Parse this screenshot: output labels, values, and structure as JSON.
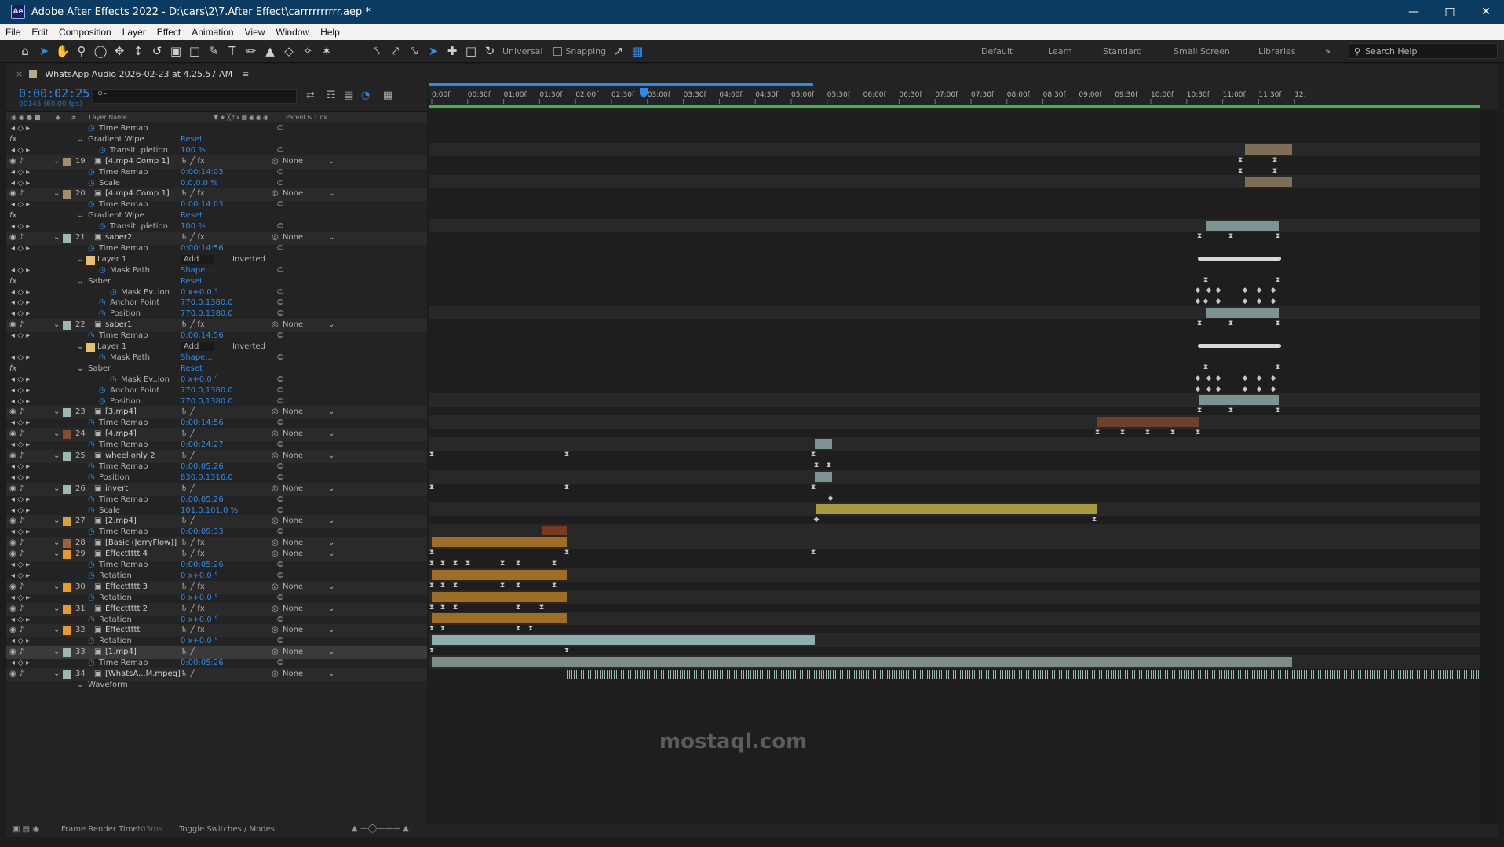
{
  "title": "Adobe After Effects 2022 - D:\\cars\\2\\7.After Effect\\carrrrrrrrrr.aep *",
  "menu": [
    "File",
    "Edit",
    "Composition",
    "Layer",
    "Effect",
    "Animation",
    "View",
    "Window",
    "Help"
  ],
  "toolbar": {
    "universal": "Universal",
    "snapping": "Snapping"
  },
  "workspaces": [
    "Default",
    "Learn",
    "Standard",
    "Small Screen",
    "Libraries"
  ],
  "search_help": "Search Help",
  "panel": {
    "comp_name": "WhatsApp Audio 2026-02-23 at 4.25.57 AM",
    "timecode": "0:00:02:25",
    "fps": "00145 (60.00 fps)"
  },
  "columns": {
    "layer_name": "Layer Name",
    "parent": "Parent & Link"
  },
  "ruler": [
    "0:00f",
    "00:30f",
    "01:00f",
    "01:30f",
    "02:00f",
    "02:30f",
    "03:00f",
    "03:30f",
    "04:00f",
    "04:30f",
    "05:00f",
    "05:30f",
    "06:00f",
    "06:30f",
    "07:00f",
    "07:30f",
    "08:00f",
    "08:30f",
    "09:00f",
    "09:30f",
    "10:00f",
    "10:30f",
    "11:00f",
    "11:30f",
    "12:"
  ],
  "rows": [
    {
      "t": "prop",
      "ind": 2,
      "name": "Time Remap",
      "val": ""
    },
    {
      "t": "group",
      "ind": 1,
      "name": "Gradient Wipe",
      "val": "Reset",
      "fx": true
    },
    {
      "t": "prop",
      "ind": 3,
      "name": "Transit..pletion",
      "val": "100 %"
    },
    {
      "t": "layer",
      "num": "19",
      "name": "[4.mp4 Comp 1]",
      "color": "#a58f6a",
      "parent": "None",
      "fx": true
    },
    {
      "t": "prop",
      "ind": 2,
      "name": "Time Remap",
      "val": "0:00:14:03"
    },
    {
      "t": "prop",
      "ind": 2,
      "name": "Scale",
      "val": "0.0,0.0 %"
    },
    {
      "t": "layer",
      "num": "20",
      "name": "[4.mp4 Comp 1]",
      "color": "#a58f6a",
      "parent": "None",
      "fx": true
    },
    {
      "t": "prop",
      "ind": 2,
      "name": "Time Remap",
      "val": "0:00:14:03"
    },
    {
      "t": "group",
      "ind": 1,
      "name": "Gradient Wipe",
      "val": "Reset",
      "fx": true
    },
    {
      "t": "prop",
      "ind": 3,
      "name": "Transit..pletion",
      "val": "100 %"
    },
    {
      "t": "layer",
      "num": "21",
      "name": "saber2",
      "color": "#9fb7b4",
      "parent": "None",
      "fx": true
    },
    {
      "t": "prop",
      "ind": 2,
      "name": "Time Remap",
      "val": "0:00:14:56"
    },
    {
      "t": "mask",
      "ind": 1,
      "name": "Layer 1",
      "mode": "Add",
      "inv": "Inverted"
    },
    {
      "t": "prop",
      "ind": 3,
      "name": "Mask Path",
      "val": "Shape..."
    },
    {
      "t": "group",
      "ind": 1,
      "name": "Saber",
      "val": "Reset",
      "fx": true
    },
    {
      "t": "prop",
      "ind": 4,
      "name": "Mask Ev..ion",
      "val": "0 x+0.0 °"
    },
    {
      "t": "prop",
      "ind": 3,
      "name": "Anchor Point",
      "val": "770.0,1380.0"
    },
    {
      "t": "prop",
      "ind": 3,
      "name": "Position",
      "val": "770.0,1380.0"
    },
    {
      "t": "layer",
      "num": "22",
      "name": "saber1",
      "color": "#9fb7b4",
      "parent": "None",
      "fx": true
    },
    {
      "t": "prop",
      "ind": 2,
      "name": "Time Remap",
      "val": "0:00:14:56"
    },
    {
      "t": "mask",
      "ind": 1,
      "name": "Layer 1",
      "mode": "Add",
      "inv": "Inverted"
    },
    {
      "t": "prop",
      "ind": 3,
      "name": "Mask Path",
      "val": "Shape..."
    },
    {
      "t": "group",
      "ind": 1,
      "name": "Saber",
      "val": "Reset",
      "fx": true
    },
    {
      "t": "prop",
      "ind": 4,
      "name": "Mask Ev..ion",
      "val": "0 x+0.0 °"
    },
    {
      "t": "prop",
      "ind": 3,
      "name": "Anchor Point",
      "val": "770.0,1380.0"
    },
    {
      "t": "prop",
      "ind": 3,
      "name": "Position",
      "val": "770.0,1380.0"
    },
    {
      "t": "layer",
      "num": "23",
      "name": "[3.mp4]",
      "color": "#9fb7b4",
      "parent": "None"
    },
    {
      "t": "prop",
      "ind": 2,
      "name": "Time Remap",
      "val": "0:00:14:56"
    },
    {
      "t": "layer",
      "num": "24",
      "name": "[4.mp4]",
      "color": "#8a4a30",
      "parent": "None"
    },
    {
      "t": "prop",
      "ind": 2,
      "name": "Time Remap",
      "val": "0:00:24:27"
    },
    {
      "t": "layer",
      "num": "25",
      "name": "wheel only 2",
      "color": "#9fb7b4",
      "parent": "None"
    },
    {
      "t": "prop",
      "ind": 2,
      "name": "Time Remap",
      "val": "0:00:05:26"
    },
    {
      "t": "prop",
      "ind": 2,
      "name": "Position",
      "val": "830.0,1316.0"
    },
    {
      "t": "layer",
      "num": "26",
      "name": "invert",
      "color": "#9fb7b4",
      "parent": "None"
    },
    {
      "t": "prop",
      "ind": 2,
      "name": "Time Remap",
      "val": "0:00:05:26"
    },
    {
      "t": "prop",
      "ind": 2,
      "name": "Scale",
      "val": "101.0,101.0 %"
    },
    {
      "t": "layer",
      "num": "27",
      "name": "[2.mp4]",
      "color": "#d7a239",
      "parent": "None"
    },
    {
      "t": "prop",
      "ind": 2,
      "name": "Time Remap",
      "val": "0:00:09:33"
    },
    {
      "t": "layer",
      "num": "28",
      "name": "[Basic (JerryFlow)]",
      "color": "#a0603a",
      "parent": "None",
      "fx": true
    },
    {
      "t": "layer",
      "num": "29",
      "name": "Effecttttt 4",
      "color": "#e89b2c",
      "parent": "None",
      "fx": true
    },
    {
      "t": "prop",
      "ind": 2,
      "name": "Time Remap",
      "val": "0:00:05:26"
    },
    {
      "t": "prop",
      "ind": 2,
      "name": "Rotation",
      "val": "0 x+0.0 °"
    },
    {
      "t": "layer",
      "num": "30",
      "name": "Effecttttt 3",
      "color": "#e89b2c",
      "parent": "None",
      "fx": true
    },
    {
      "t": "prop",
      "ind": 2,
      "name": "Rotation",
      "val": "0 x+0.0 °"
    },
    {
      "t": "layer",
      "num": "31",
      "name": "Effecttttt 2",
      "color": "#e89b2c",
      "parent": "None",
      "fx": true
    },
    {
      "t": "prop",
      "ind": 2,
      "name": "Rotation",
      "val": "0 x+0.0 °"
    },
    {
      "t": "layer",
      "num": "32",
      "name": "Effecttttt",
      "color": "#e89b2c",
      "parent": "None",
      "fx": true
    },
    {
      "t": "prop",
      "ind": 2,
      "name": "Rotation",
      "val": "0 x+0.0 °"
    },
    {
      "t": "layer",
      "num": "33",
      "name": "[1.mp4]",
      "color": "#9fb7b4",
      "parent": "None",
      "sel": true
    },
    {
      "t": "prop",
      "ind": 2,
      "name": "Time Remap",
      "val": "0:00:05:26"
    },
    {
      "t": "layer",
      "num": "34",
      "name": "[WhatsA...M.mpeg]",
      "color": "#9fb7b4",
      "parent": "None"
    },
    {
      "t": "group",
      "ind": 1,
      "name": "Waveform",
      "val": ""
    }
  ],
  "status": {
    "render_label": "Frame Render Time:",
    "render_val": "103ms",
    "toggle": "Toggle Switches / Modes"
  },
  "watermark": "mostaql.com"
}
